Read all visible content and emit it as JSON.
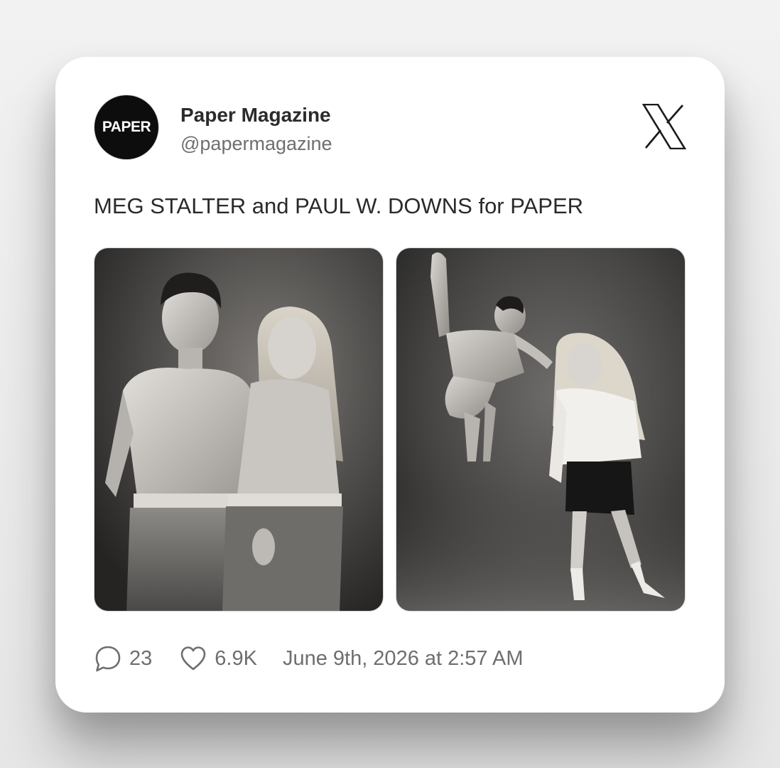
{
  "author": {
    "avatar_text": "PAPER",
    "display_name": "Paper Magazine",
    "handle": "@papermagazine"
  },
  "platform_icon": "x-logo-icon",
  "tweet": {
    "text": "MEG STALTER and PAUL W. DOWNS for PAPER"
  },
  "media": [
    {
      "kind": "photo",
      "description_icon": "photo-image"
    },
    {
      "kind": "photo",
      "description_icon": "photo-image"
    }
  ],
  "stats": {
    "reply_icon": "speech-bubble-icon",
    "replies": "23",
    "like_icon": "heart-icon",
    "likes": "6.9K",
    "timestamp": "June 9th, 2026 at 2:57 AM"
  },
  "colors": {
    "card_background": "#ffffff",
    "page_background": "#ececec",
    "primary_text": "#2a2a2a",
    "secondary_text": "#6e6e6e",
    "avatar_background": "#0d0d0d"
  }
}
